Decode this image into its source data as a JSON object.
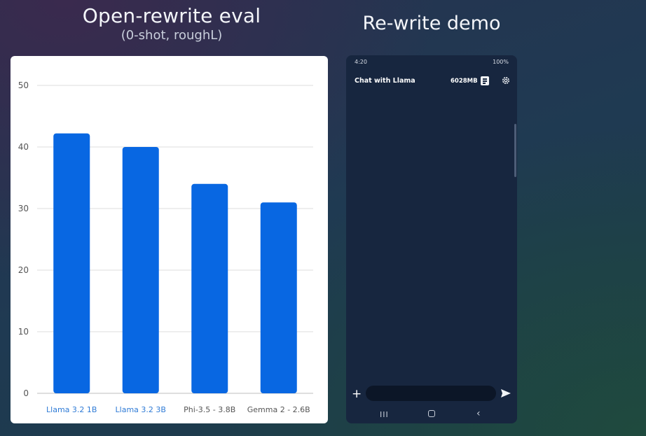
{
  "chart_title": "Open-rewrite eval",
  "chart_subtitle": "(0-shot, roughL)",
  "demo_title": "Re-write demo",
  "chart_data": {
    "type": "bar",
    "title": "Open-rewrite eval",
    "subtitle": "(0-shot, roughL)",
    "categories": [
      "Llama 3.2 1B",
      "Llama 3.2 3B",
      "Phi-3.5 - 3.8B",
      "Gemma 2 - 2.6B"
    ],
    "values": [
      42.2,
      40.0,
      34.0,
      31.0
    ],
    "ylim": [
      0,
      50
    ],
    "yticks": [
      0,
      10,
      20,
      30,
      40,
      50
    ],
    "grid": true,
    "bar_color": "#0867e2",
    "highlight_label_color": "#2f7bd6",
    "label_color": "#555555",
    "highlighted_categories": [
      0,
      1
    ]
  },
  "phone": {
    "status_time": "4:20",
    "status_battery": "100%",
    "app_title": "Chat with Llama",
    "memory": "6028MB",
    "icons": [
      "document-icon",
      "gear-icon",
      "plus-icon",
      "send-icon"
    ],
    "nav_recent": "III",
    "nav_back": "‹"
  }
}
